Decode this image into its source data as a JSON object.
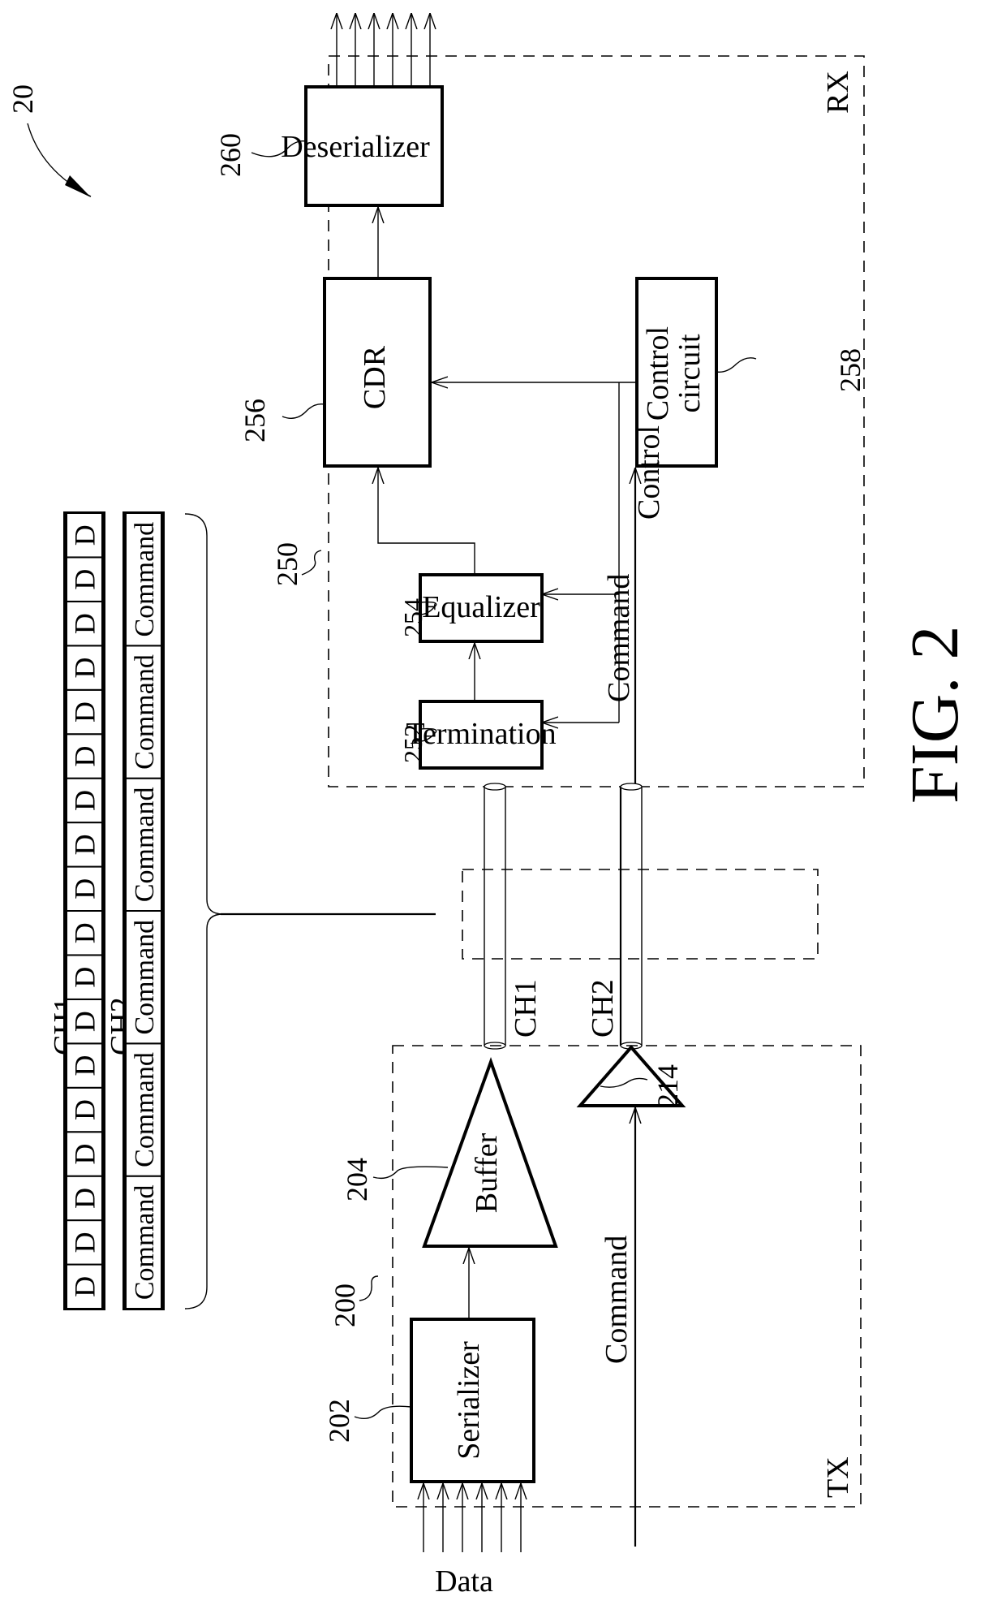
{
  "figure": {
    "caption": "FIG. 2",
    "system_ref": "20"
  },
  "rx": {
    "label": "RX",
    "ref": "250",
    "blocks": {
      "deserializer": {
        "label": "Deserializer",
        "ref": "260"
      },
      "cdr": {
        "label": "CDR",
        "ref": "256"
      },
      "control_circuit": {
        "label_line1": "Control",
        "label_line2": "circuit",
        "ref": "258"
      },
      "equalizer": {
        "label": "Equalizer",
        "ref": "254"
      },
      "termination": {
        "label": "Termination",
        "ref": "252"
      }
    },
    "control_signal_label": "Control",
    "command_signal_label": "Command",
    "output_arrow_count": 6
  },
  "tx": {
    "label": "TX",
    "ref": "200",
    "blocks": {
      "serializer": {
        "label": "Serializer",
        "ref": "202"
      },
      "buffer": {
        "label": "Buffer",
        "ref": "204"
      },
      "command_buffer": {
        "ref": "214"
      }
    },
    "data_input_label": "Data",
    "command_input_label": "Command",
    "input_arrow_count": 6
  },
  "channels": [
    {
      "name": "CH1"
    },
    {
      "name": "CH2"
    }
  ],
  "timing": {
    "rows": [
      {
        "name": "CH1",
        "cells": [
          "D",
          "D",
          "D",
          "D",
          "D",
          "D",
          "D",
          "D",
          "D",
          "D",
          "D",
          "D",
          "D",
          "D",
          "D",
          "D",
          "D",
          "D"
        ]
      },
      {
        "name": "CH2",
        "cells": [
          "Command",
          "Command",
          "Command",
          "Command",
          "Command",
          "Command"
        ]
      }
    ]
  }
}
